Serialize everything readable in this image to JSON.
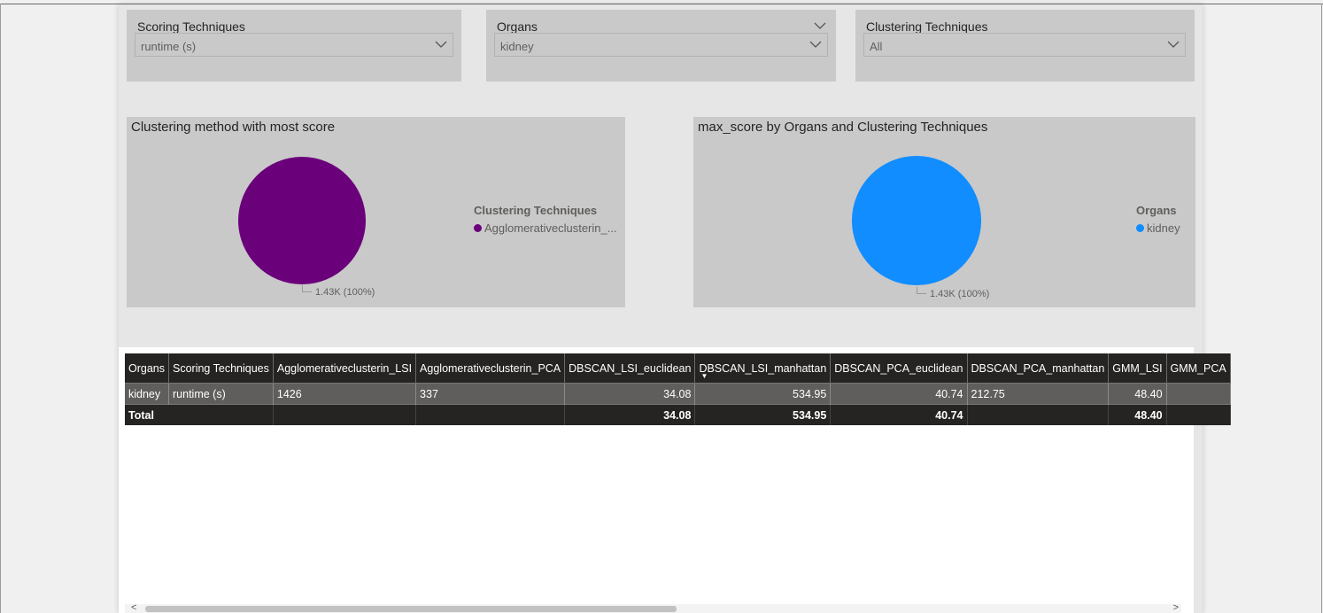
{
  "slicers": [
    {
      "title": "Scoring Techniques",
      "value": "runtime (s)"
    },
    {
      "title": "Organs",
      "value": "kidney"
    },
    {
      "title": "Clustering Techniques",
      "value": "All"
    }
  ],
  "pie_left": {
    "title": "Clustering method with most score",
    "legend_title": "Clustering Techniques",
    "legend_item": "Agglomerativeclusterin_...",
    "data_label": "1.43K (100%)",
    "color": "#6b007b"
  },
  "pie_right": {
    "title": "max_score by Organs and Clustering Techniques",
    "legend_title": "Organs",
    "legend_item": "kidney",
    "data_label": "1.43K (100%)",
    "color": "#118dff"
  },
  "chart_data": [
    {
      "type": "pie",
      "title": "Clustering method with most score",
      "legend_title": "Clustering Techniques",
      "labels": [
        "Agglomerativeclusterin_..."
      ],
      "values": [
        1430
      ],
      "data_labels": [
        "1.43K (100%)"
      ],
      "colors": [
        "#6b007b"
      ],
      "legend": "right"
    },
    {
      "type": "pie",
      "title": "max_score by Organs and Clustering Techniques",
      "legend_title": "Organs",
      "labels": [
        "kidney"
      ],
      "values": [
        1430
      ],
      "data_labels": [
        "1.43K (100%)"
      ],
      "colors": [
        "#118dff"
      ],
      "legend": "right"
    }
  ],
  "table": {
    "headers": [
      "Organs",
      "Scoring Techniques",
      "Agglomerativeclusterin_LSI",
      "Agglomerativeclusterin_PCA",
      "DBSCAN_LSI_euclidean",
      "DBSCAN_LSI_manhattan",
      "DBSCAN_PCA_euclidean",
      "DBSCAN_PCA_manhattan",
      "GMM_LSI",
      "GMM_PCA"
    ],
    "row": [
      "kidney",
      "runtime (s)",
      "1426",
      "337",
      "34.08",
      "534.95",
      "40.74",
      "212.75",
      "48.40",
      ""
    ],
    "total": [
      "Total",
      "",
      "",
      "",
      "34.08",
      "534.95",
      "40.74",
      "",
      "48.40",
      ""
    ],
    "sort_indicator": "▼"
  },
  "scroll": {
    "left": "<",
    "right": ">"
  }
}
